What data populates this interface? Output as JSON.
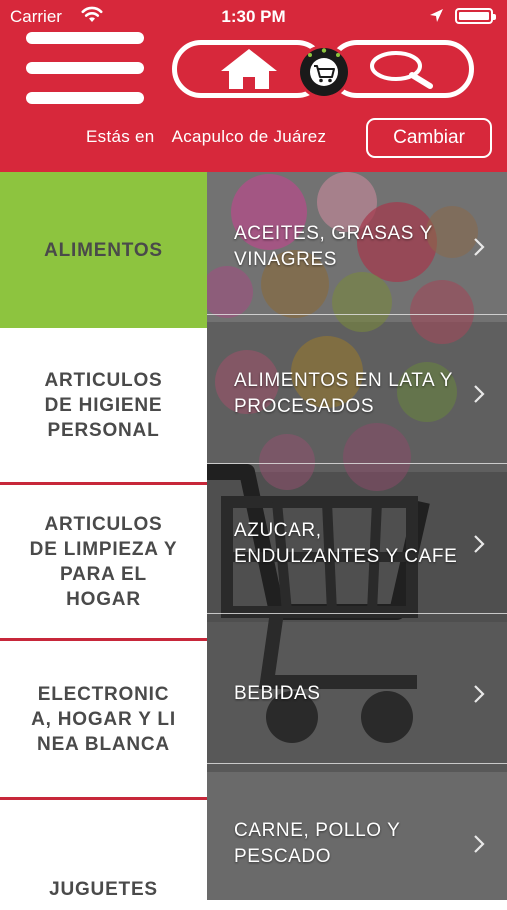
{
  "status_bar": {
    "carrier": "Carrier",
    "time": "1:30 PM"
  },
  "header": {
    "location_prefix": "Estás en",
    "location_city": "Acapulco de Juárez",
    "change_button": "Cambiar",
    "brand_color": "#d7283b",
    "icons": [
      "menu-icon",
      "home-icon",
      "cart-badge-icon",
      "search-icon"
    ]
  },
  "categories": [
    {
      "label": "ALIMENTOS",
      "selected": true
    },
    {
      "label": "ARTICULOS DE HIGIENE PERSONAL",
      "selected": false
    },
    {
      "label": "ARTICULOS DE LIMPIEZA Y PARA EL HOGAR",
      "selected": false
    },
    {
      "label": "ELECTRONICA, HOGAR Y LINEA BLANCA",
      "selected": false
    },
    {
      "label": "JUGUETES",
      "selected": false
    }
  ],
  "subcategories": [
    {
      "label": "ACEITES, GRASAS Y VINAGRES"
    },
    {
      "label": "ALIMENTOS EN LATA Y PROCESADOS"
    },
    {
      "label": "AZUCAR, ENDULZANTES Y CAFE"
    },
    {
      "label": "BEBIDAS"
    },
    {
      "label": "CARNE, POLLO Y PESCADO"
    }
  ],
  "colors": {
    "selected_category": "#8dc43f",
    "category_separator": "#c7273a",
    "text_dark": "#4a4a4a"
  }
}
